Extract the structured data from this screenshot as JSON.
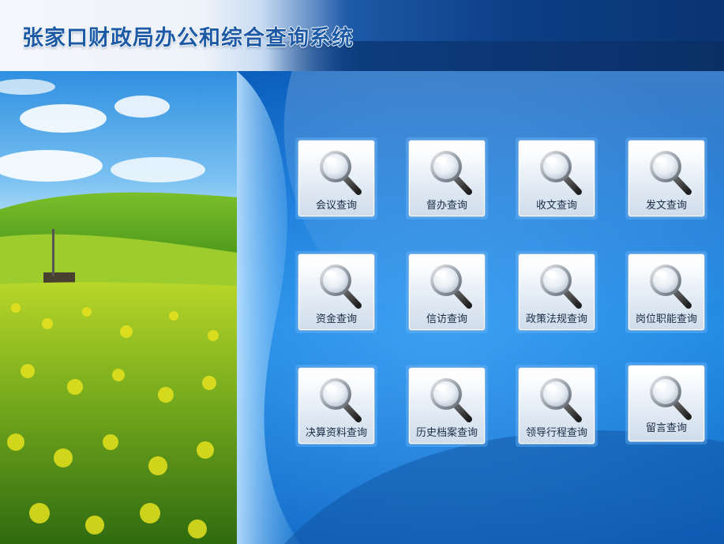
{
  "header": {
    "title": "张家口财政局办公和综合查询系统"
  },
  "colors": {
    "title": "#1d5aa6",
    "background": "#0f6fd0",
    "tile_label": "#1a2c44"
  },
  "icon": "magnifier-icon",
  "queries": [
    {
      "label": "会议查询"
    },
    {
      "label": "督办查询"
    },
    {
      "label": "收文查询"
    },
    {
      "label": "发文查询"
    },
    {
      "label": "资金查询"
    },
    {
      "label": "信访查询"
    },
    {
      "label": "政策法规查询"
    },
    {
      "label": "岗位职能查询"
    },
    {
      "label": "决算资料查询"
    },
    {
      "label": "历史档案查询"
    },
    {
      "label": "领导行程查询"
    },
    {
      "label": "留言查询"
    }
  ]
}
